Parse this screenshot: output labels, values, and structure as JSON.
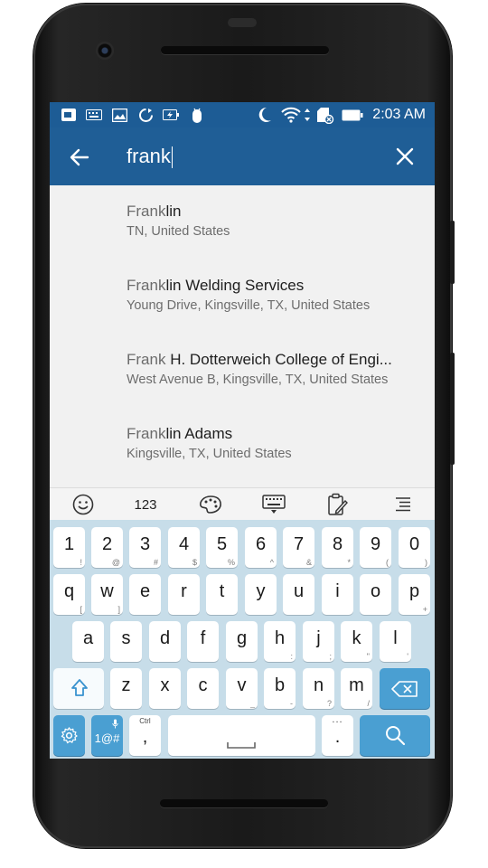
{
  "status_bar": {
    "time": "2:03 AM",
    "left_icons": [
      "screen-cast-icon",
      "keyboard-icon",
      "image-icon",
      "sync-icon",
      "battery-saver-icon",
      "android-debug-icon"
    ],
    "right_icons": [
      "moon-icon",
      "wifi-icon",
      "sd-card-icon",
      "battery-icon"
    ]
  },
  "toolbar": {
    "query_matched": "frank",
    "query_rest": ""
  },
  "results": [
    {
      "match": "Frank",
      "rest": "lin",
      "subtitle": "TN, United States"
    },
    {
      "match": "Frank",
      "rest": "lin Welding Services",
      "subtitle": "Young Drive, Kingsville, TX, United States"
    },
    {
      "match": "Frank",
      "rest": " H. Dotterweich College of Engi...",
      "subtitle": "West Avenue B, Kingsville, TX, United States"
    },
    {
      "match": "Frank",
      "rest": "lin Adams",
      "subtitle": "Kingsville, TX, United States"
    }
  ],
  "keyboard_toolbar": {
    "numbers_label": "123",
    "icons": [
      "emoji-icon",
      "theme-palette-icon",
      "keyboard-hide-icon",
      "clipboard-icon",
      "menu-icon"
    ]
  },
  "keyboard": {
    "row1": [
      {
        "main": "1",
        "sub": "!"
      },
      {
        "main": "2",
        "sub": "@"
      },
      {
        "main": "3",
        "sub": "#"
      },
      {
        "main": "4",
        "sub": "$"
      },
      {
        "main": "5",
        "sub": "%"
      },
      {
        "main": "6",
        "sub": "^"
      },
      {
        "main": "7",
        "sub": "&"
      },
      {
        "main": "8",
        "sub": "*"
      },
      {
        "main": "9",
        "sub": "("
      },
      {
        "main": "0",
        "sub": ")"
      }
    ],
    "row2": [
      {
        "main": "q",
        "sub": "["
      },
      {
        "main": "w",
        "sub": "]"
      },
      {
        "main": "e",
        "sub": ""
      },
      {
        "main": "r",
        "sub": ""
      },
      {
        "main": "t",
        "sub": ""
      },
      {
        "main": "y",
        "sub": ""
      },
      {
        "main": "u",
        "sub": ""
      },
      {
        "main": "i",
        "sub": ""
      },
      {
        "main": "o",
        "sub": ""
      },
      {
        "main": "p",
        "sub": "+"
      }
    ],
    "row3": [
      {
        "main": "a",
        "sub": ""
      },
      {
        "main": "s",
        "sub": ""
      },
      {
        "main": "d",
        "sub": ""
      },
      {
        "main": "f",
        "sub": ""
      },
      {
        "main": "g",
        "sub": ""
      },
      {
        "main": "h",
        "sub": ":"
      },
      {
        "main": "j",
        "sub": ";"
      },
      {
        "main": "k",
        "sub": "\""
      },
      {
        "main": "l",
        "sub": "'"
      }
    ],
    "row4": [
      {
        "main": "z",
        "sub": ""
      },
      {
        "main": "x",
        "sub": ""
      },
      {
        "main": "c",
        "sub": ""
      },
      {
        "main": "v",
        "sub": "_"
      },
      {
        "main": "b",
        "sub": "-"
      },
      {
        "main": "n",
        "sub": "?"
      },
      {
        "main": "m",
        "sub": "/"
      }
    ],
    "symbols_label": "1@#",
    "comma_label": ",",
    "comma_sub": "Ctrl",
    "period_label": ".",
    "period_sub": "..."
  },
  "colors": {
    "status_bar": "#1d5c95",
    "toolbar": "#1f5e96",
    "key_accent": "#4a9fd2",
    "keyboard_bg": "#c7dde9"
  }
}
